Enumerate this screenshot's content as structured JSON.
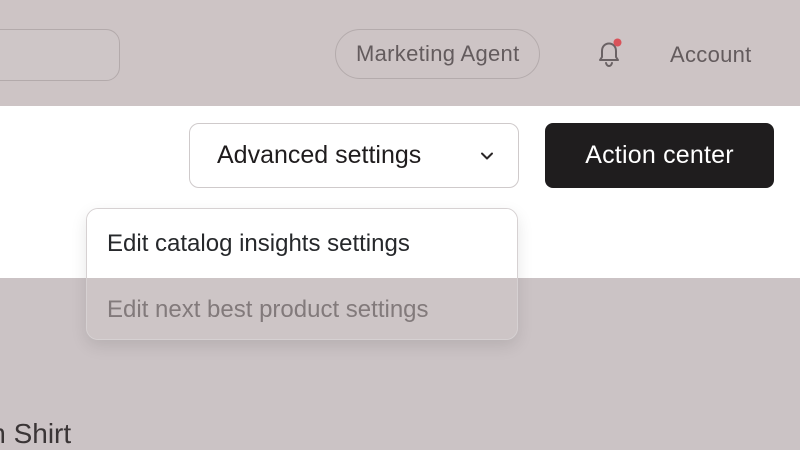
{
  "header": {
    "agent_label": "Marketing Agent",
    "account_label": "Account",
    "notification_color": "#d9535a"
  },
  "toolbar": {
    "advanced_settings_label": "Advanced settings",
    "action_center_label": "Action center"
  },
  "menu": {
    "items": [
      {
        "label": "Edit catalog insights settings"
      },
      {
        "label": "Edit next best product settings"
      }
    ]
  },
  "content": {
    "title": "wn Shirt"
  }
}
